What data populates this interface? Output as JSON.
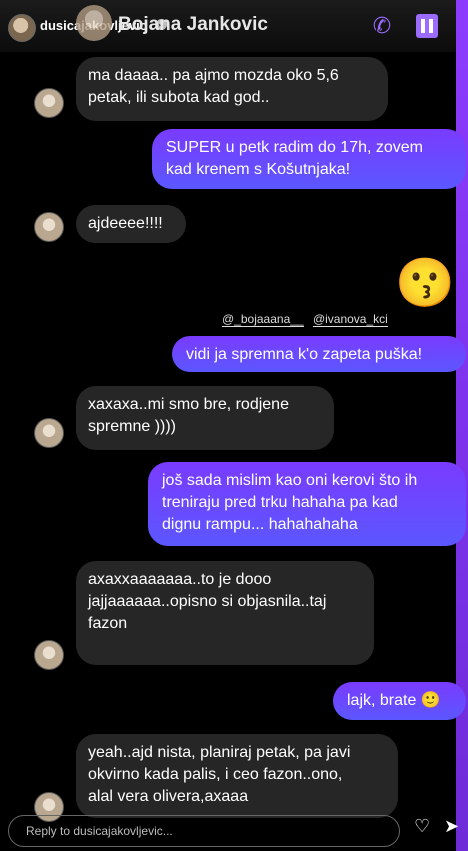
{
  "story": {
    "username": "dusicajakovljevic",
    "verified_icon": "verified-badge-icon"
  },
  "chat": {
    "name": "Bojana Jankovic",
    "call_icon": "phone-icon",
    "video_icon": "video-icon"
  },
  "messages": [
    {
      "side": "received",
      "text": "ma daaaa.. pa ajmo mozda oko 5,6\npetak, ili subota kad god.."
    },
    {
      "side": "sent",
      "text": "SUPER u petk radim do 17h, zovem\nkad krenem s Košutnjaka!"
    },
    {
      "side": "received",
      "text": "ajdeeee!!!!"
    },
    {
      "side": "emoji",
      "text": "😗"
    },
    {
      "side": "mention",
      "text": [
        "@_bojaaana__",
        "@ivanova_kci"
      ]
    },
    {
      "side": "sent",
      "text": "vidi ja spremna k'o zapeta puška!"
    },
    {
      "side": "received",
      "text": "xaxaxa..mi smo bre, rodjene\nspremne ))))"
    },
    {
      "side": "sent",
      "text": "još sada mislim kao oni kerovi što ih\ntreniraju pred trku hahaha pa kad\ndignu rampu... hahahahaha"
    },
    {
      "side": "received",
      "text": "axaxxaaaaaaa..to je dooo\njajjaaaaaa..opisno si objasnila..taj\nfazon"
    },
    {
      "side": "sent",
      "text": "lajk, brate 🙂"
    },
    {
      "side": "received",
      "text": "yeah..ajd nista, planiraj petak, pa javi\nokvirno kada palis, i ceo fazon..ono,\nalal vera olivera,axaaa"
    }
  ],
  "reply": {
    "placeholder": "Reply to dusicajakovljevic...",
    "heart_icon": "heart-icon",
    "send_icon": "send-icon"
  }
}
